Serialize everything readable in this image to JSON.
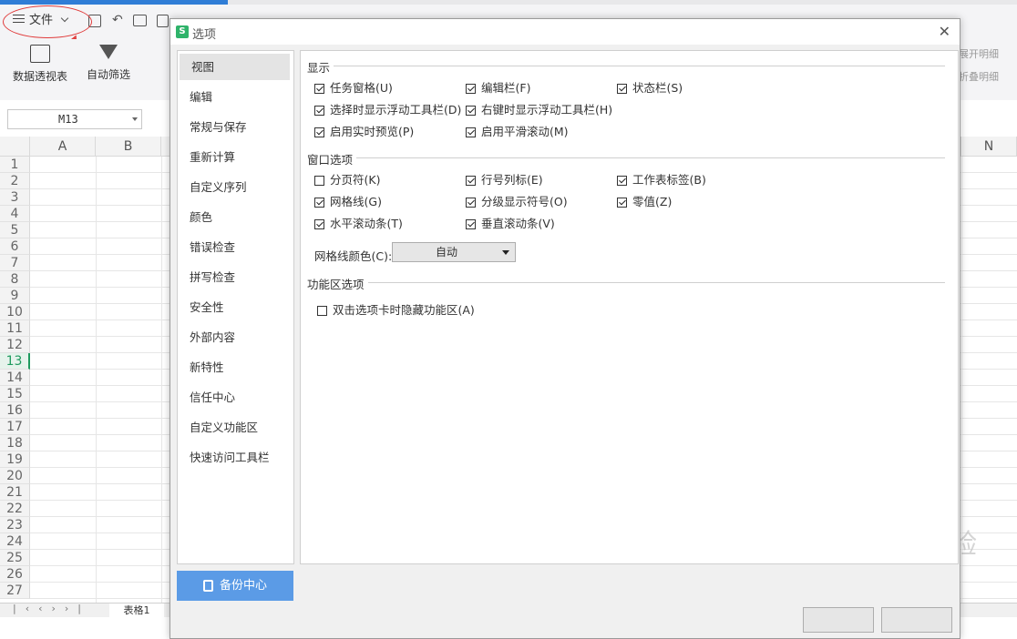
{
  "app": {
    "file_menu_label": "文件",
    "ribbon_buttons": [
      {
        "label": "数据透视表"
      },
      {
        "label": "自动筛选"
      }
    ],
    "name_box": "M13",
    "columns": [
      "A",
      "B",
      "N"
    ],
    "rows": [
      "1",
      "2",
      "3",
      "4",
      "5",
      "6",
      "7",
      "8",
      "9",
      "10",
      "11",
      "12",
      "13",
      "14",
      "15",
      "16",
      "17",
      "18",
      "19",
      "20",
      "21",
      "22",
      "23",
      "24",
      "25",
      "26",
      "27"
    ],
    "active_row": "13",
    "sheet_tab": "表格1",
    "right_ribbon_texts": [
      "展开明细",
      "折叠明细"
    ]
  },
  "dialog": {
    "title": "选项",
    "logo_letter": "S",
    "close_glyph": "✕",
    "nav_items": [
      {
        "label": "视图",
        "selected": true
      },
      {
        "label": "编辑"
      },
      {
        "label": "常规与保存"
      },
      {
        "label": "重新计算"
      },
      {
        "label": "自定义序列"
      },
      {
        "label": "颜色"
      },
      {
        "label": "错误检查"
      },
      {
        "label": "拼写检查"
      },
      {
        "label": "安全性"
      },
      {
        "label": "外部内容"
      },
      {
        "label": "新特性"
      },
      {
        "label": "信任中心"
      },
      {
        "label": "自定义功能区"
      },
      {
        "label": "快速访问工具栏"
      }
    ],
    "backup_button": "备份中心",
    "sections": {
      "display": {
        "title": "显示",
        "options": [
          {
            "label": "任务窗格(U)",
            "checked": true
          },
          {
            "label": "编辑栏(F)",
            "checked": true
          },
          {
            "label": "状态栏(S)",
            "checked": true
          },
          {
            "label": "选择时显示浮动工具栏(D)",
            "checked": true
          },
          {
            "label": "右键时显示浮动工具栏(H)",
            "checked": true
          },
          {
            "label": "启用实时预览(P)",
            "checked": true
          },
          {
            "label": "启用平滑滚动(M)",
            "checked": true
          }
        ]
      },
      "window": {
        "title": "窗口选项",
        "options": [
          {
            "label": "分页符(K)",
            "checked": false
          },
          {
            "label": "行号列标(E)",
            "checked": true
          },
          {
            "label": "工作表标签(B)",
            "checked": true
          },
          {
            "label": "网格线(G)",
            "checked": true
          },
          {
            "label": "分级显示符号(O)",
            "checked": true
          },
          {
            "label": "零值(Z)",
            "checked": true
          },
          {
            "label": "水平滚动条(T)",
            "checked": true
          },
          {
            "label": "垂直滚动条(V)",
            "checked": true
          }
        ],
        "gridline_color_label": "网格线颜色(C):",
        "gridline_color_value": "自动"
      },
      "ribbon": {
        "title": "功能区选项",
        "options": [
          {
            "label": "双击选项卡时隐藏功能区(A)",
            "checked": false
          }
        ]
      }
    }
  },
  "colors": {
    "accent_blue": "#5b9be6",
    "annotation_red": "#e03a3a",
    "active_green": "#1f9a5f"
  }
}
